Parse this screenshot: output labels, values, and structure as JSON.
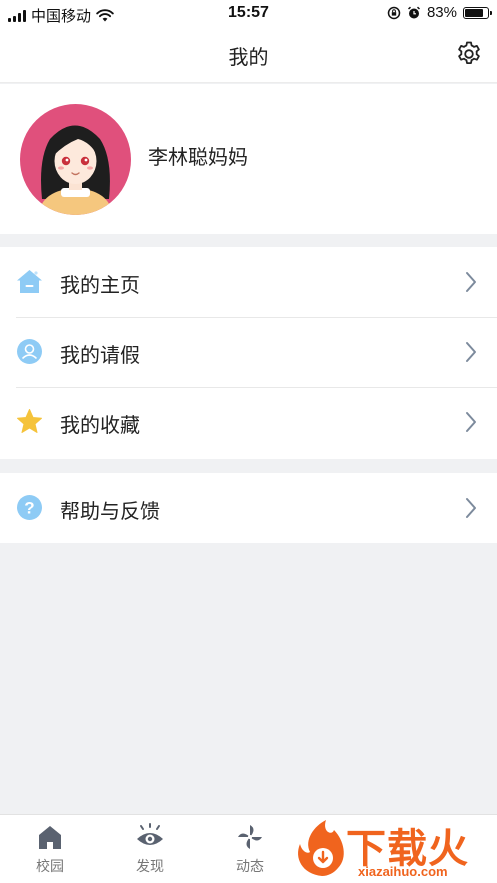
{
  "status_bar": {
    "carrier": "中国移动",
    "time": "15:57",
    "battery_percent": "83%",
    "battery_level": 0.83
  },
  "nav": {
    "title": "我的"
  },
  "profile": {
    "name": "李林聪妈妈"
  },
  "menu": {
    "group1": [
      {
        "label": "我的主页",
        "icon": "home-icon"
      },
      {
        "label": "我的请假",
        "icon": "leave-icon"
      },
      {
        "label": "我的收藏",
        "icon": "star-icon"
      }
    ],
    "group2": [
      {
        "label": "帮助与反馈",
        "icon": "help-icon"
      }
    ]
  },
  "tabs": [
    {
      "label": "校园",
      "icon": "campus-icon"
    },
    {
      "label": "发现",
      "icon": "discover-eye-icon"
    },
    {
      "label": "动态",
      "icon": "pinwheel-icon"
    }
  ],
  "watermark": {
    "text": "下载火",
    "sub": "xiazaihuo.com"
  },
  "colors": {
    "avatar_bg": "#e0507c",
    "icon_blue": "#7fc0f2",
    "star_yellow": "#f5c33b",
    "watermark_orange": "#f0641e"
  }
}
